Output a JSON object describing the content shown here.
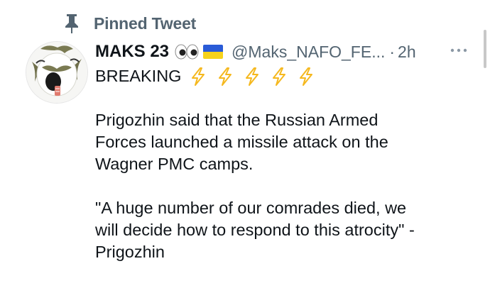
{
  "pinned": {
    "label": "Pinned Tweet",
    "icon": "pin-icon"
  },
  "author": {
    "display_name": "MAKS 23",
    "emoji_icons": [
      "eyes-icon",
      "ukraine-flag-icon"
    ],
    "handle": "@Maks_NAFO_FE...",
    "separator": "·",
    "time": "2h"
  },
  "more_icon": "more-horizontal-icon",
  "body": {
    "headline": "BREAKING",
    "bolt_count": 5,
    "bolt_icon": "lightning-icon",
    "paragraph1": [
      "Prigozhin said that the Russian Armed",
      "Forces launched a missile attack on the",
      "Wagner PMC camps."
    ],
    "paragraph2": [
      "\"A huge number of our comrades died, we",
      "will decide how to respond to this atrocity\" -",
      "Prigozhin"
    ]
  },
  "colors": {
    "text": "#0f1419",
    "secondary": "#536471",
    "bolt": "#f5b81e",
    "flag_blue": "#2a5bd7",
    "flag_yellow": "#f6d21b"
  }
}
